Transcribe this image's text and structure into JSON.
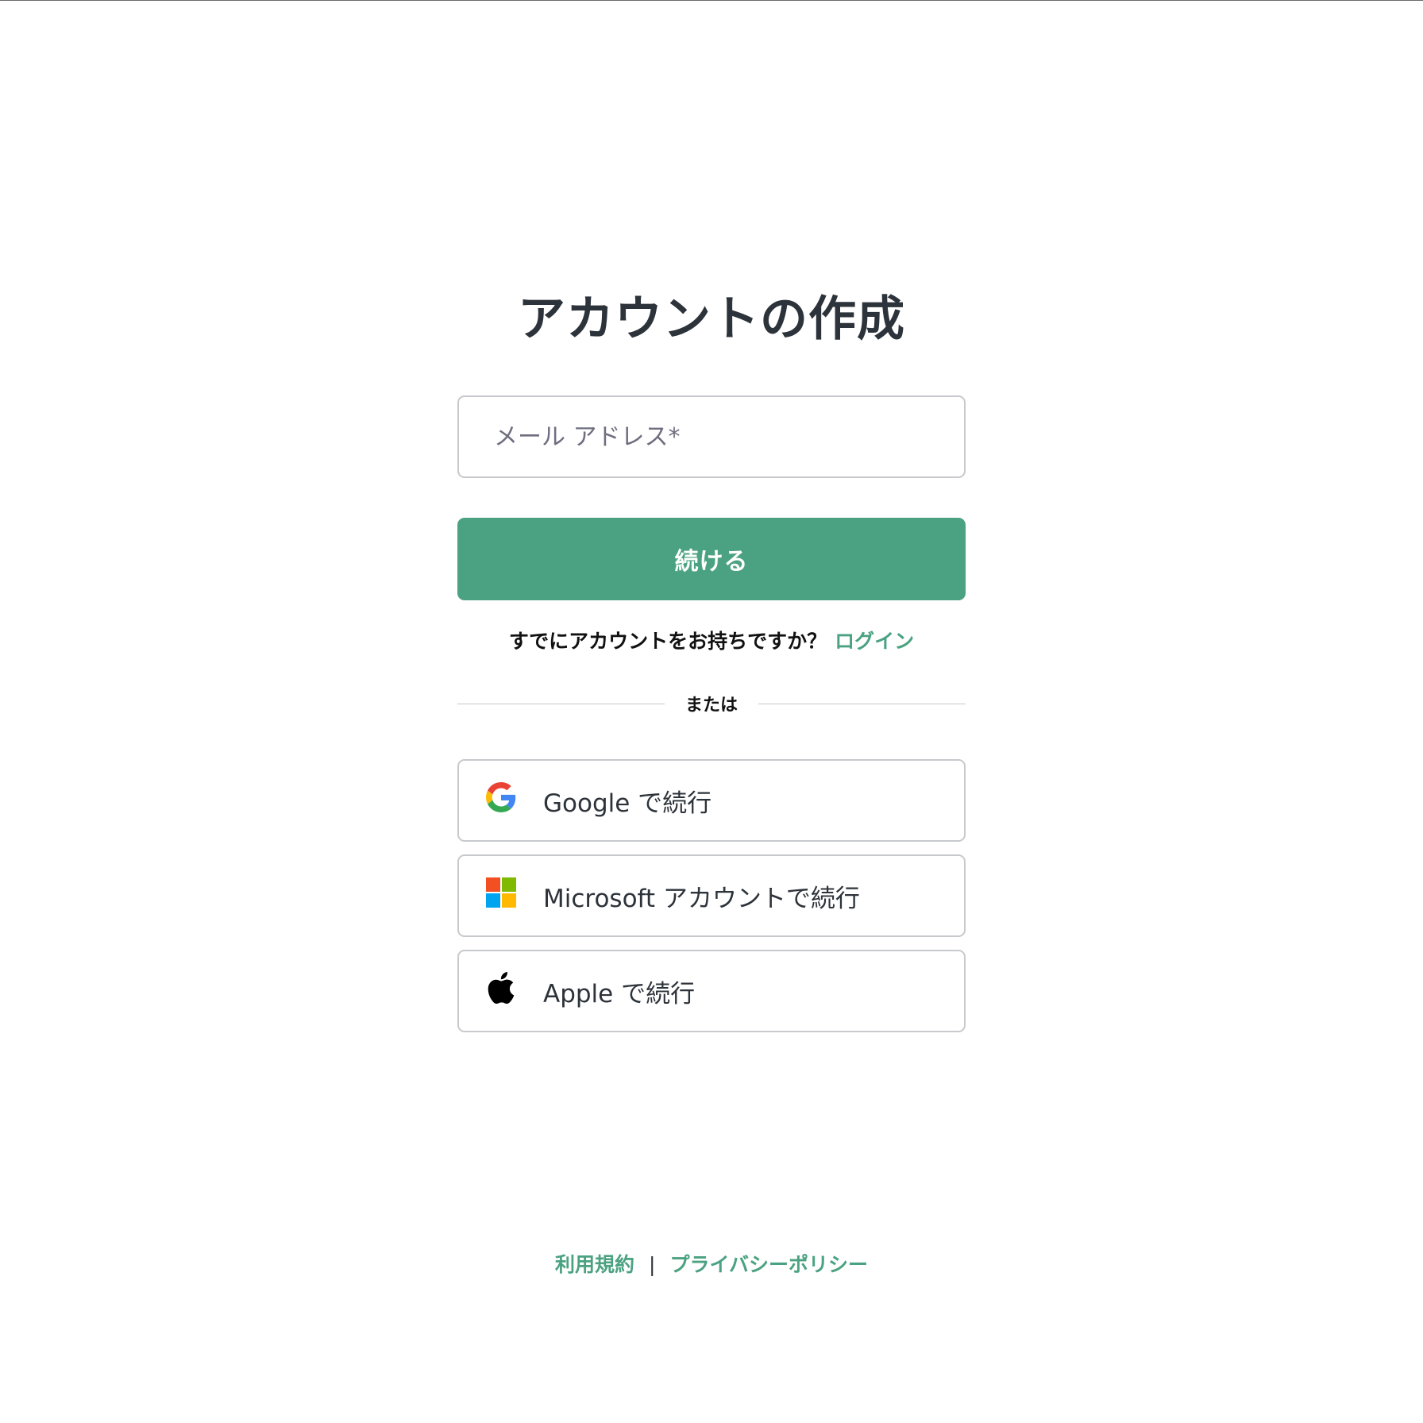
{
  "heading": "アカウントの作成",
  "email": {
    "placeholder": "メール アドレス*",
    "value": ""
  },
  "continue_label": "続ける",
  "login_prompt": {
    "text": "すでにアカウントをお持ちですか？",
    "link": "ログイン"
  },
  "divider_text": "または",
  "social": {
    "google_label": "Google で続行",
    "microsoft_label": "Microsoft アカウントで続行",
    "apple_label": "Apple で続行"
  },
  "footer": {
    "terms": "利用規約",
    "separator": "|",
    "privacy": "プライバシーポリシー"
  },
  "icons": [
    "google-icon",
    "microsoft-icon",
    "apple-icon"
  ],
  "colors": {
    "accent": "#4ba282",
    "text": "#2d333a",
    "border": "#c7c9cd",
    "microsoft": [
      "#f25022",
      "#7fba00",
      "#00a4ef",
      "#ffb900"
    ]
  }
}
